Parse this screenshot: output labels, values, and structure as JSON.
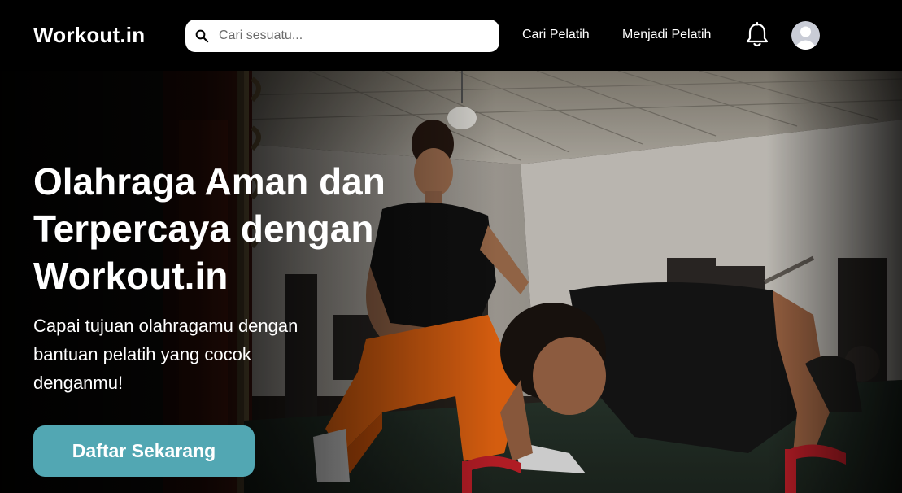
{
  "navbar": {
    "logo": "Workout.in",
    "search": {
      "placeholder": "Cari sesuatu..."
    },
    "links": [
      {
        "label": "Cari Pelatih"
      },
      {
        "label": "Menjadi Pelatih"
      }
    ],
    "icons": {
      "notification": "bell-icon",
      "profile": "user-avatar-icon"
    }
  },
  "hero": {
    "title": "Olahraga Aman dan Terpercaya dengan Workout.in",
    "subtitle": "Capai tujuan olahragamu dengan bantuan pelatih yang cocok denganmu!",
    "cta_label": "Daftar Sekarang"
  },
  "colors": {
    "navbar_bg": "#000000",
    "cta_bg": "#52a7b3",
    "text": "#ffffff",
    "avatar_bg": "#c9ccd6"
  }
}
